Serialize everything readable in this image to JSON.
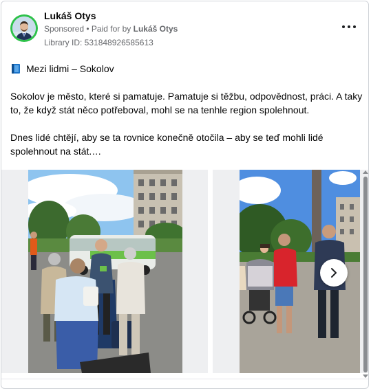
{
  "header": {
    "name": "Lukáš Otys",
    "sponsored": "Sponsored",
    "separator": " • ",
    "paid_for_prefix": "Paid for by ",
    "paid_for_name": "Lukáš Otys",
    "library_id": "Library ID: 531848926585613"
  },
  "post": {
    "title_icon": "blue-book-icon",
    "title": "Mezi lidmi – Sokolov",
    "paragraph1": "Sokolov je město, které si pamatuje. Pamatuje si těžbu, odpovědnost, práci. A taky to, že když stát něco potřeboval, mohl se na tenhle region spolehnout.",
    "paragraph2": "Dnes lidé chtějí, aby se ta rovnice konečně otočila – aby se teď mohli lidé spolehnout na stát.…"
  },
  "icons": {
    "more": "more-horizontal-icon",
    "next": "chevron-right-icon"
  },
  "colors": {
    "avatar_ring": "#2ec24a",
    "secondary_text": "#65676b",
    "van_accent": "#6cc04a"
  }
}
